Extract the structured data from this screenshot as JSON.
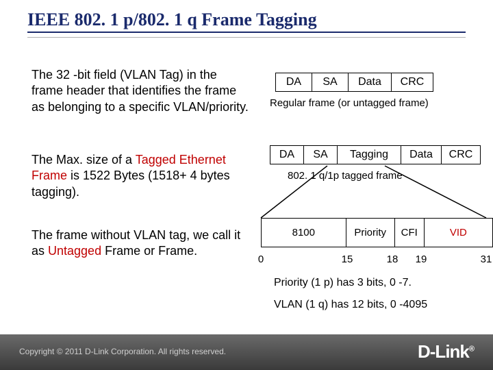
{
  "title": "IEEE 802. 1 p/802. 1 q Frame Tagging",
  "paragraphs": {
    "p1_a": "The 32 -bit field (VLAN Tag) in the frame header that identifies the frame as belonging to a specific VLAN/priority.",
    "p2_a": "The Max. size of a ",
    "p2_red": "Tagged Ethernet Frame",
    "p2_b": " is 1522 Bytes (1518+ 4 bytes tagging).",
    "p3_a": "The frame without VLAN tag, we call it as ",
    "p3_red": "Untagged",
    "p3_b": " Frame or Frame."
  },
  "untagged_frame": {
    "da": "DA",
    "sa": "SA",
    "data": "Data",
    "crc": "CRC",
    "caption": "Regular frame (or untagged frame)"
  },
  "tagged_frame": {
    "da": "DA",
    "sa": "SA",
    "tag": "Tagging",
    "data": "Data",
    "crc": "CRC",
    "caption": "802. 1 q/1p tagged frame"
  },
  "bitfields": {
    "f1": "8100",
    "f2": "Priority",
    "f3": "CFI",
    "f4": "VID",
    "bits": {
      "b0": "0",
      "b1": "15",
      "b2": "18",
      "b3": "19",
      "b4": "31"
    }
  },
  "notes": {
    "priority": "Priority (1 p) has 3 bits, 0 -7.",
    "vlan": "VLAN (1 q)  has 12 bits, 0 -4095"
  },
  "footer": {
    "copyright": "Copyright © 2011  D-Link Corporation. All rights reserved.",
    "brand": "D-Link"
  }
}
